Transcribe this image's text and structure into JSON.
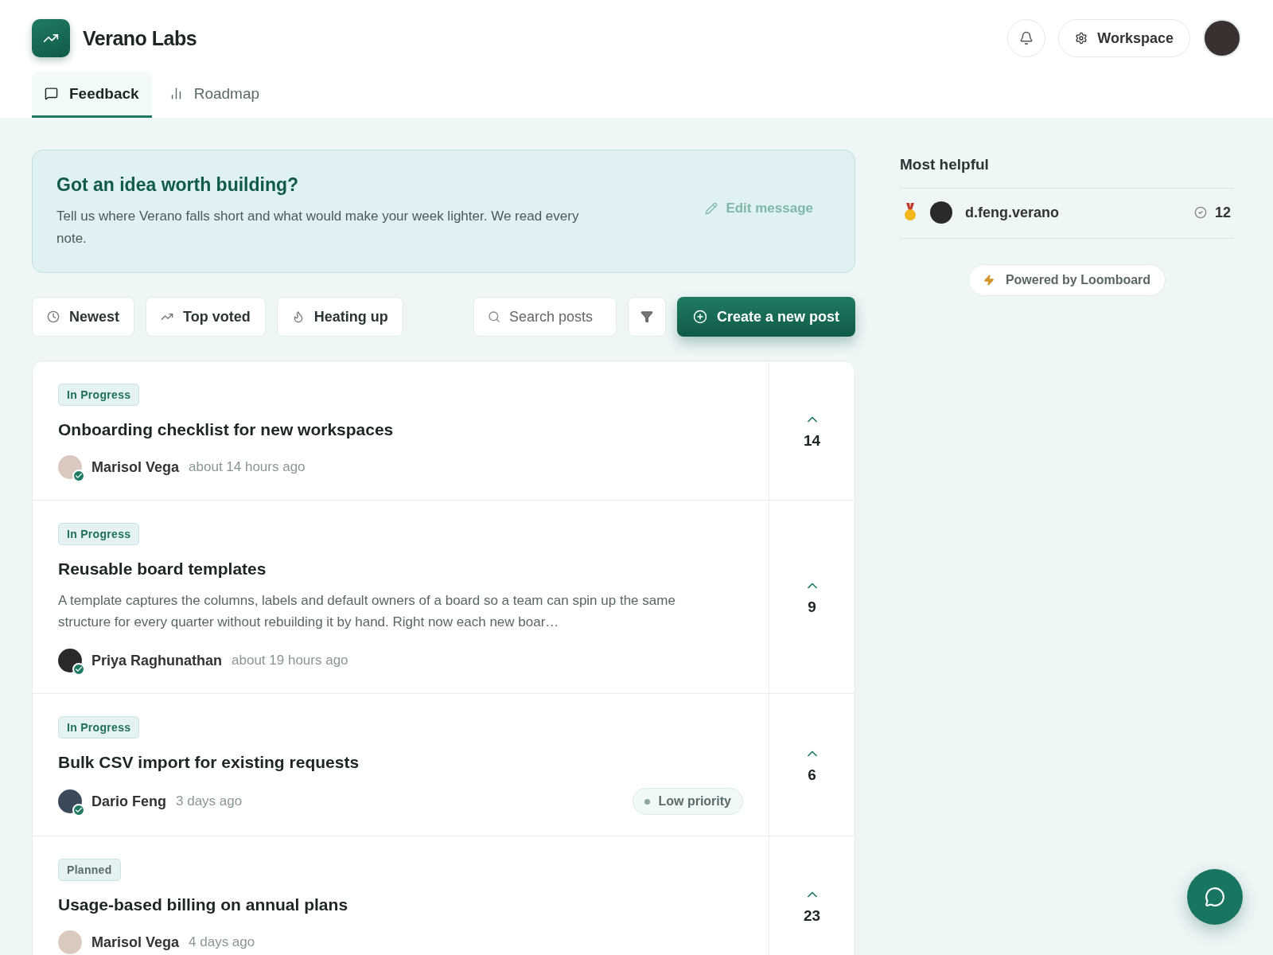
{
  "brand": {
    "name": "Verano Labs"
  },
  "header": {
    "workspace_button": "Workspace"
  },
  "tabs": [
    {
      "label": "Feedback",
      "selected": true
    },
    {
      "label": "Roadmap",
      "selected": false
    }
  ],
  "banner": {
    "title": "Got an idea worth building?",
    "text": "Tell us where Verano falls short and what would make your week lighter. We read every note.",
    "edit_button": "Edit message"
  },
  "sort_buttons": [
    {
      "label": "Newest",
      "selected": false
    },
    {
      "label": "Top voted",
      "selected": false
    },
    {
      "label": "Heating up",
      "selected": false
    }
  ],
  "search": {
    "placeholder": "Search posts"
  },
  "create_button": "Create a new post",
  "posts": [
    {
      "status": {
        "label": "In Progress",
        "color": "#1f6f5c"
      },
      "title": "Onboarding checklist for new workspaces",
      "author": "Marisol Vega",
      "verified": true,
      "time": "about 14 hours ago",
      "votes": "14"
    },
    {
      "status": {
        "label": "In Progress",
        "color": "#1f6f5c"
      },
      "title": "Reusable board templates",
      "excerpt": "A template captures the columns, labels and default owners of a board so a team can spin up the same structure for every quarter without rebuilding it by hand. Right now each new boar…",
      "author": "Priya Raghunathan",
      "verified": true,
      "time": "about 19 hours ago",
      "votes": "9"
    },
    {
      "status": {
        "label": "In Progress",
        "color": "#1f6f5c"
      },
      "title": "Bulk CSV import for existing requests",
      "author": "Dario Feng",
      "verified": true,
      "time": "3 days ago",
      "priority": {
        "label": "Low priority",
        "color": "#8aa6a0"
      },
      "votes": "6"
    },
    {
      "status": {
        "label": "Planned",
        "color": "#5a6b6a"
      },
      "title": "Usage-based billing on annual plans",
      "author": "Marisol Vega",
      "verified": false,
      "time": "4 days ago",
      "votes": "23"
    }
  ],
  "sidebar": {
    "title": "Most helpful",
    "leaders": [
      {
        "name": "d.feng.verano",
        "count": "12"
      }
    ],
    "powered_by": "Powered by Loomboard"
  }
}
